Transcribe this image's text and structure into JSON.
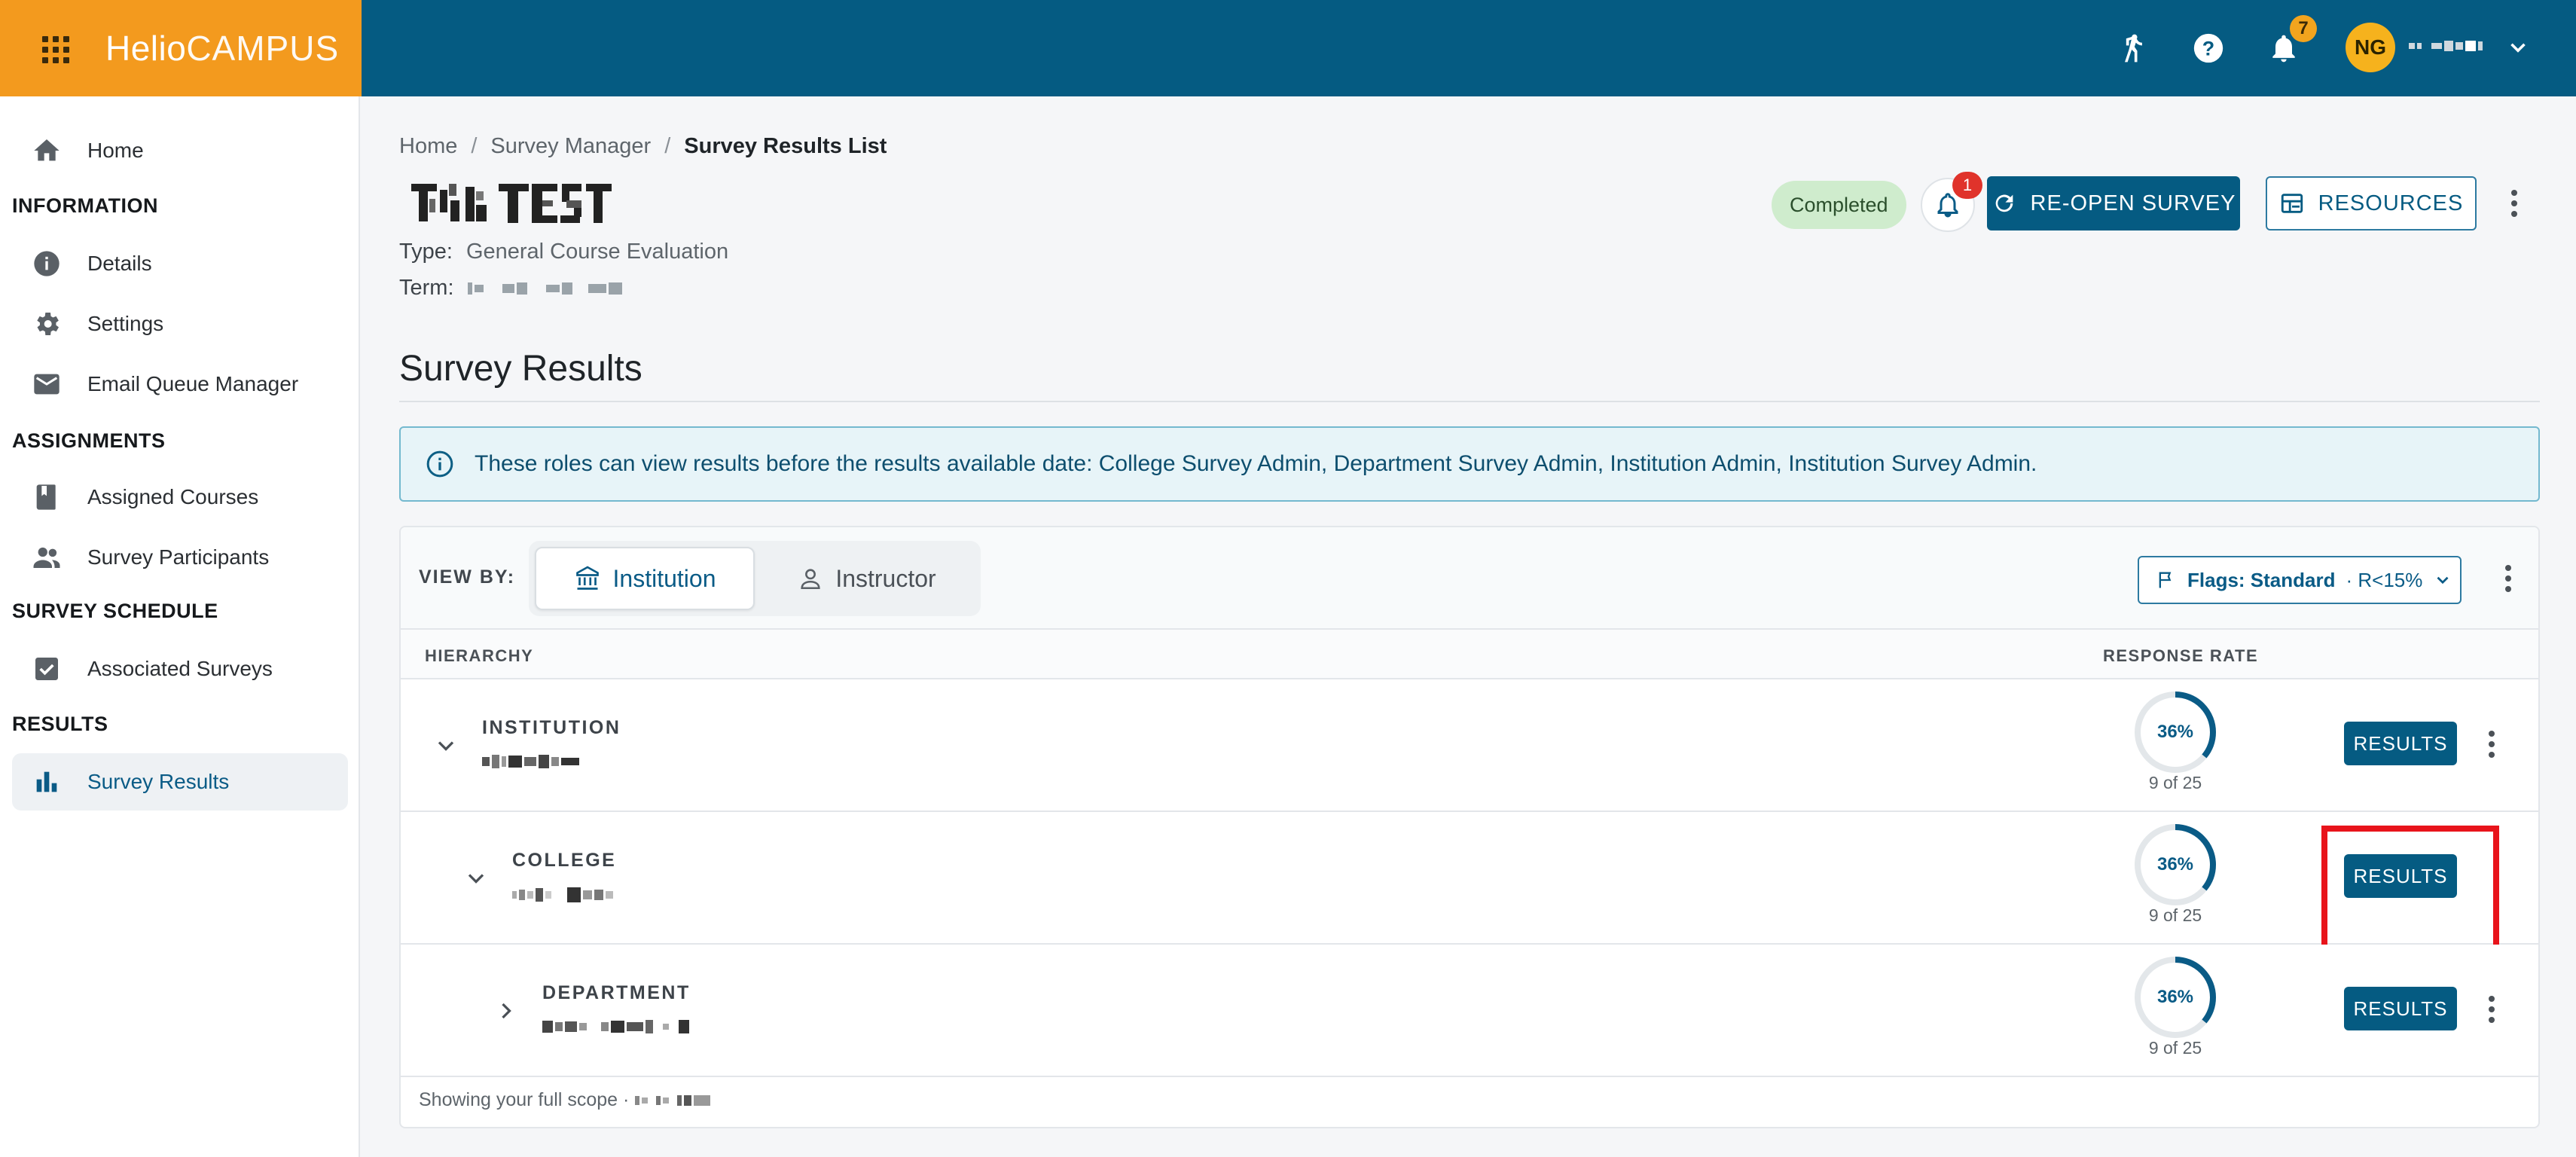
{
  "app": {
    "brand_primary": "Helio",
    "brand_secondary": "CAMPUS",
    "colors": {
      "topbar": "#055b82",
      "brand_block": "#f39a1e",
      "accent": "#055b82",
      "status_ok": "#cfeccd",
      "highlight": "#e8141b"
    }
  },
  "topbar": {
    "icons": [
      "waffle-menu-icon",
      "accessibility-icon",
      "help-icon",
      "notifications-icon",
      "chevron-down-icon"
    ],
    "notifications_count": "7",
    "user_initials": "NG"
  },
  "sidebar": {
    "home": "Home",
    "sections": {
      "information": "INFORMATION",
      "assignments": "ASSIGNMENTS",
      "survey_schedule": "SURVEY SCHEDULE",
      "results": "RESULTS"
    },
    "items": {
      "details": "Details",
      "settings": "Settings",
      "email_queue": "Email Queue Manager",
      "assigned_courses": "Assigned Courses",
      "survey_participants": "Survey Participants",
      "associated_surveys": "Associated Surveys",
      "survey_results": "Survey Results"
    }
  },
  "breadcrumb": {
    "home": "Home",
    "sep": "/",
    "survey_manager": "Survey Manager",
    "current": "Survey Results List"
  },
  "survey": {
    "type_label": "Type:",
    "type_value": "General Course Evaluation",
    "term_label": "Term:",
    "status": "Completed",
    "bell_count": "1",
    "reopen_label": "RE-OPEN SURVEY",
    "resources_label": "RESOURCES"
  },
  "results_section": {
    "title": "Survey Results",
    "info_text": "These roles can view results before the results available date: College Survey Admin, Department Survey Admin, Institution Admin, Institution Survey Admin.",
    "view_by_label": "VIEW BY:",
    "view_options": [
      "Institution",
      "Instructor"
    ],
    "selected_view": "Institution",
    "flags_label": "Flags: Standard",
    "flags_suffix": "· R<15%",
    "columns": {
      "hierarchy": "HIERARCHY",
      "response_rate": "RESPONSE RATE"
    },
    "rows": [
      {
        "level": "INSTITUTION",
        "rate_label": "36%",
        "rate_fraction": 0.36,
        "count": "9 of 25",
        "action": "RESULTS",
        "expanded": true
      },
      {
        "level": "COLLEGE",
        "rate_label": "36%",
        "rate_fraction": 0.36,
        "count": "9 of 25",
        "action": "RESULTS",
        "expanded": true
      },
      {
        "level": "DEPARTMENT",
        "rate_label": "36%",
        "rate_fraction": 0.36,
        "count": "9 of 25",
        "action": "RESULTS",
        "expanded": false
      }
    ],
    "footer_text": "Showing your full scope ·"
  }
}
